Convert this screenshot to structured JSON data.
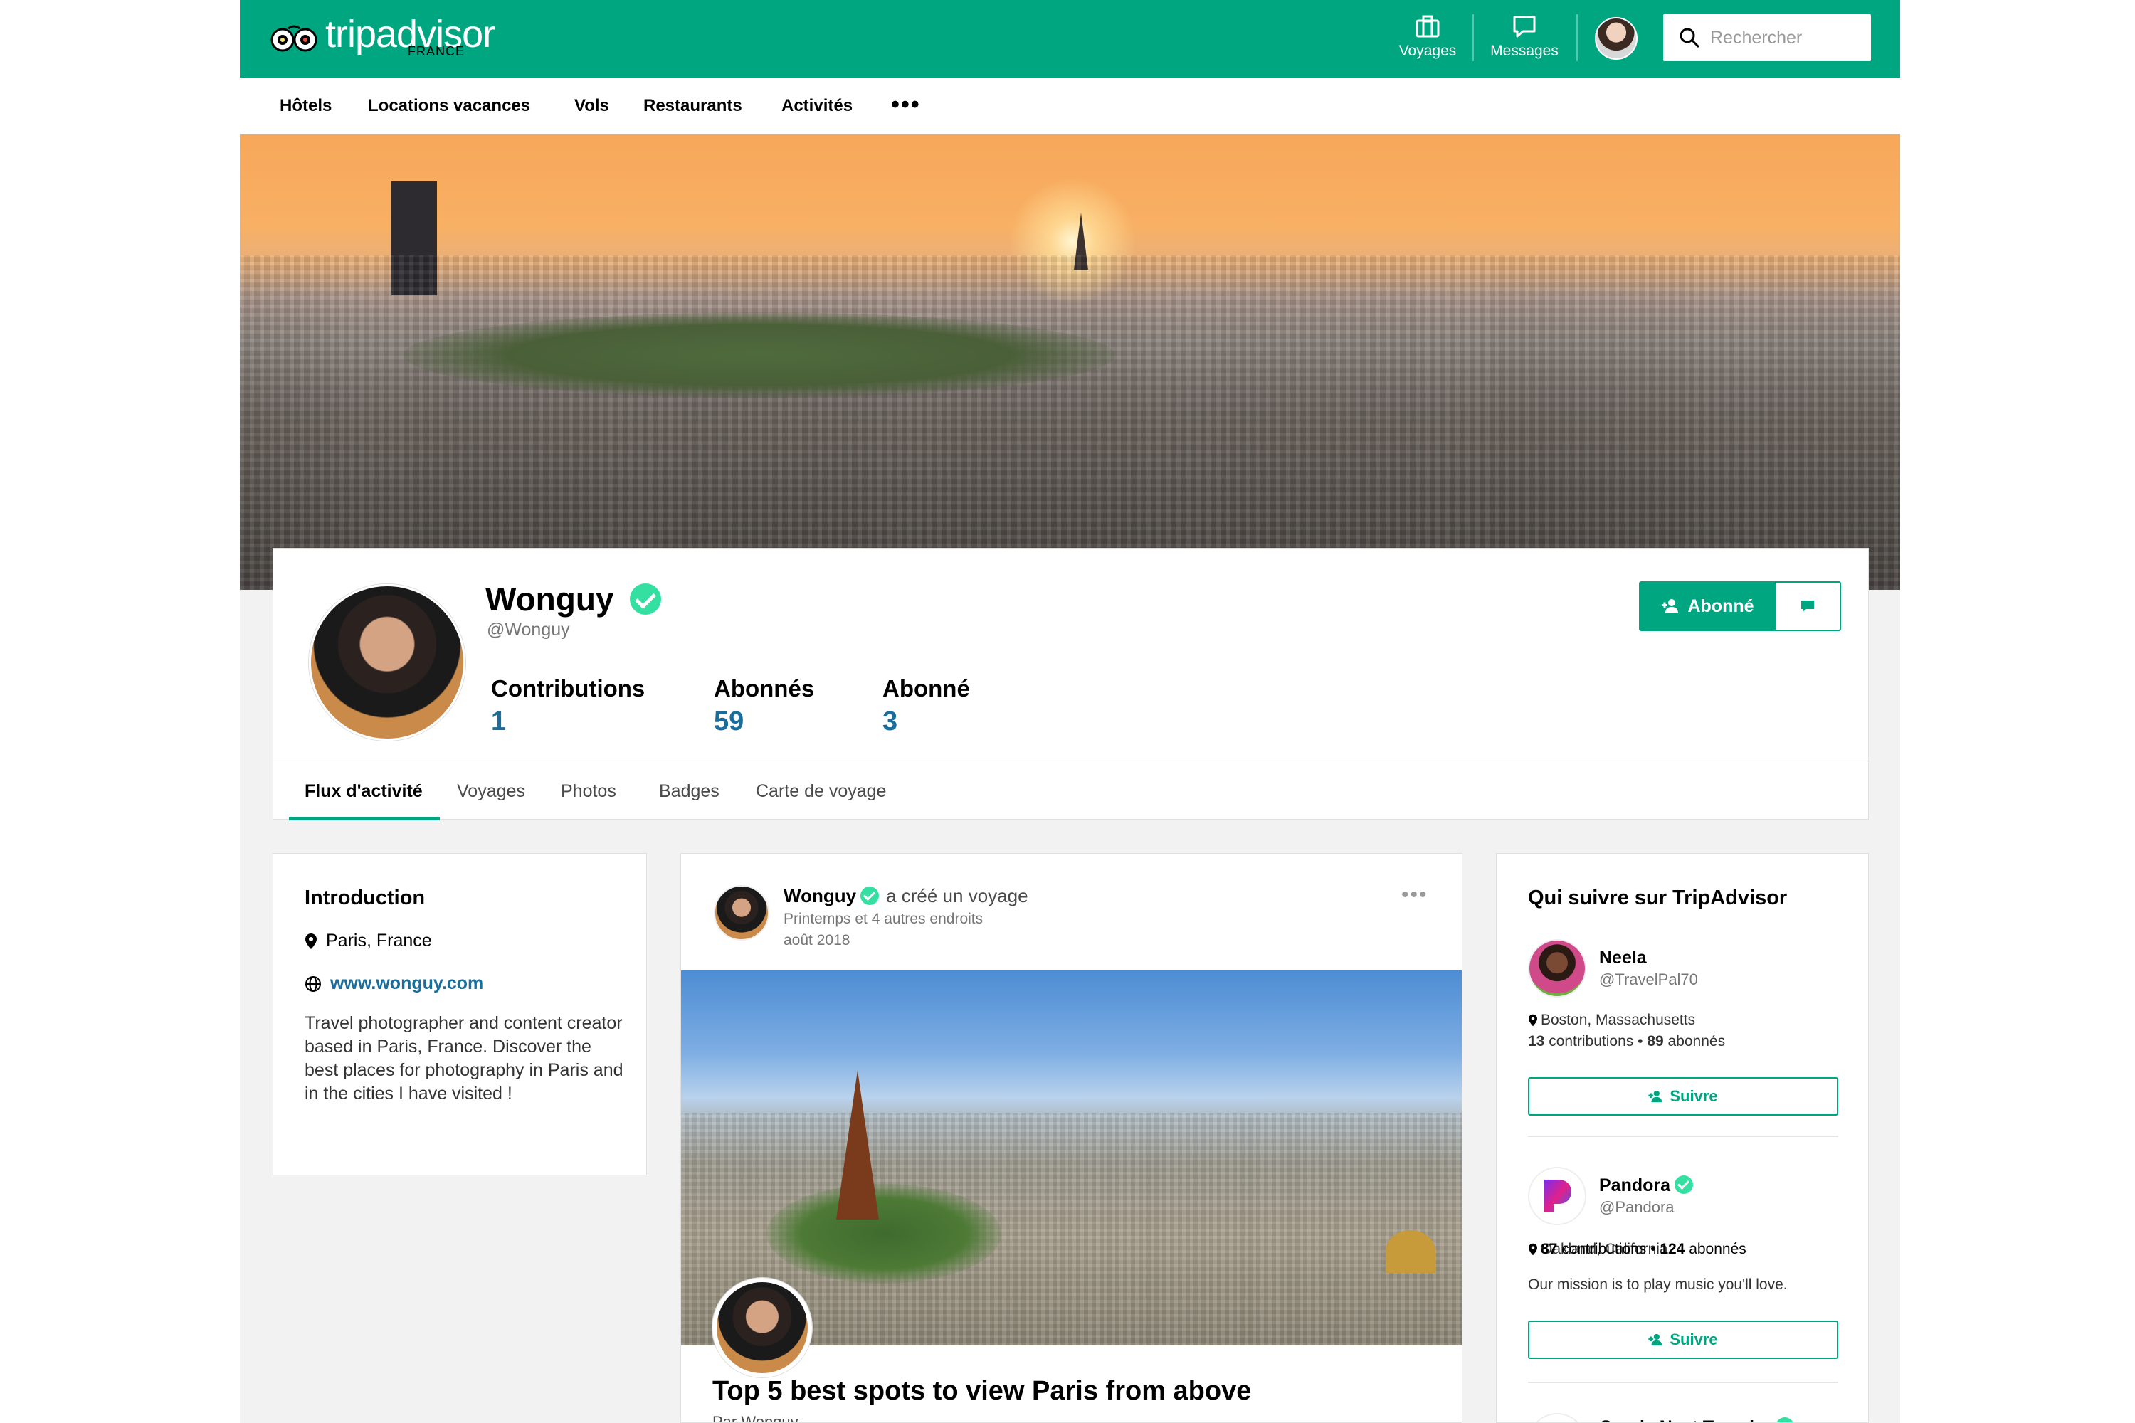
{
  "header": {
    "logo_text": "tripadvisor",
    "logo_region": "FRANCE",
    "trips_label": "Voyages",
    "messages_label": "Messages",
    "search_placeholder": "Rechercher"
  },
  "nav": {
    "items": [
      "Hôtels",
      "Locations vacances",
      "Vols",
      "Restaurants",
      "Activités"
    ],
    "more": "•••"
  },
  "profile": {
    "name": "Wonguy",
    "handle": "@Wonguy",
    "stats": [
      {
        "label": "Contributions",
        "value": "1"
      },
      {
        "label": "Abonnés",
        "value": "59"
      },
      {
        "label": "Abonné",
        "value": "3"
      }
    ],
    "follow_label": "Abonné"
  },
  "tabs": [
    "Flux d'activité",
    "Voyages",
    "Photos",
    "Badges",
    "Carte de voyage"
  ],
  "intro": {
    "title": "Introduction",
    "location": "Paris, France",
    "website": "www.wonguy.com",
    "bio": "Travel photographer and content creator based in Paris, France. Discover the best places for photography in Paris and in the cities I have visited !"
  },
  "feed": {
    "author": "Wonguy",
    "action": "a créé un voyage",
    "places": "Printemps et 4 autres endroits",
    "date": "août 2018",
    "title": "Top 5 best spots to view Paris from above",
    "byline": "Par Wonguy"
  },
  "suggestions": {
    "title": "Qui suivre sur TripAdvisor",
    "follow_label": "Suivre",
    "users": [
      {
        "name": "Neela",
        "handle": "@TravelPal70",
        "location": "Boston, Massachusetts",
        "contributions": "13",
        "contributions_label": "contributions",
        "followers": "89",
        "followers_label": "abonnés"
      },
      {
        "name": "Pandora",
        "handle": "@Pandora",
        "location": "Oakland, California",
        "contributions": "87",
        "contributions_label": "contributions",
        "followers": "124",
        "followers_label": "abonnés",
        "bio": "Our mission is to play music you'll love."
      },
      {
        "name": "Conde Nast Traveler"
      }
    ]
  },
  "colors": {
    "brand_green": "#00a680",
    "verified_green": "#34e0a1",
    "stat_blue": "#1a6e9c"
  }
}
